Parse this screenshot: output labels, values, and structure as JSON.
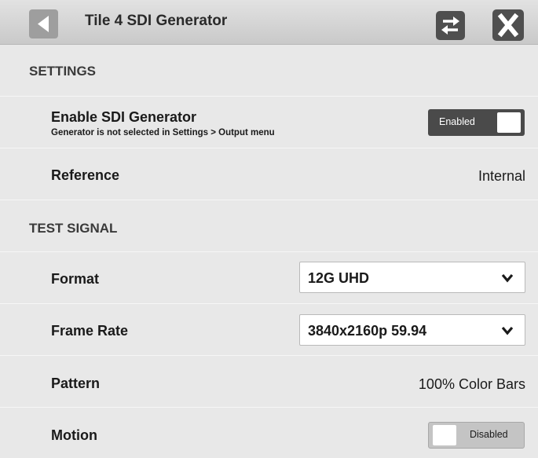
{
  "header": {
    "title": "Tile 4 SDI Generator",
    "back_icon": "back-arrow-icon",
    "swap_icon": "swap-arrows-icon",
    "close_icon": "close-x-icon"
  },
  "settings": {
    "heading": "SETTINGS",
    "enable": {
      "label": "Enable SDI Generator",
      "note": "Generator is not selected in Settings > Output menu",
      "toggle_label": "Enabled",
      "state": "on"
    },
    "reference": {
      "label": "Reference",
      "value": "Internal"
    }
  },
  "test_signal": {
    "heading": "TEST SIGNAL",
    "format": {
      "label": "Format",
      "value": "12G UHD"
    },
    "frame_rate": {
      "label": "Frame Rate",
      "value": "3840x2160p 59.94"
    },
    "pattern": {
      "label": "Pattern",
      "value": "100% Color Bars"
    },
    "motion": {
      "label": "Motion",
      "toggle_label": "Disabled",
      "state": "off"
    }
  },
  "colors": {
    "background": "#e8e8e8",
    "toggle_on": "#4a4a4a",
    "toggle_off": "#c4c4c4",
    "button_dark": "#4f4f4f"
  }
}
